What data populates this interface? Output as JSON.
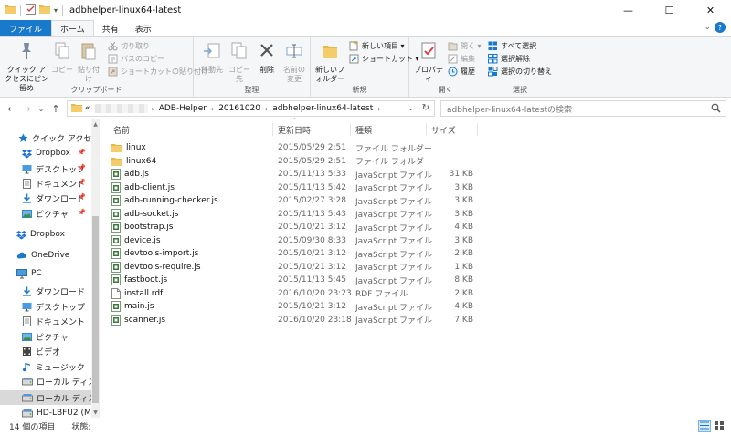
{
  "window": {
    "title": "adbhelper-linux64-latest",
    "minimize": "—",
    "maximize": "☐",
    "close": "✕"
  },
  "tabs": {
    "file": "ファイル",
    "home": "ホーム",
    "share": "共有",
    "view": "表示",
    "toggle": "⌄",
    "help": "?"
  },
  "ribbon": {
    "clipboard": {
      "pin": "クイック アクセスにピン留め",
      "copy": "コピー",
      "paste": "貼り付け",
      "cut": "切り取り",
      "copy_path": "パスのコピー",
      "paste_shortcut": "ショートカットの貼り付け",
      "label": "クリップボード"
    },
    "organize": {
      "move_to": "移動先",
      "copy_to": "コピー先",
      "delete": "削除",
      "rename": "名前の変更",
      "label": "整理"
    },
    "new": {
      "new_folder": "新しいフォルダー",
      "new_item": "新しい項目 ▾",
      "shortcut": "ショートカット ▾",
      "label": "新規"
    },
    "open": {
      "properties": "プロパティ",
      "open": "開く ▾",
      "edit": "編集",
      "history": "履歴",
      "label": "開く"
    },
    "select": {
      "select_all": "すべて選択",
      "select_none": "選択解除",
      "invert": "選択の切り替え",
      "label": "選択"
    }
  },
  "address": {
    "prefix": "«",
    "crumbs": [
      "ADB-Helper",
      "20161020",
      "adbhelper-linux64-latest"
    ],
    "dropdown": "⌄",
    "refresh": "↻",
    "search_placeholder": "adbhelper-linux64-latestの検索"
  },
  "sidebar": {
    "items": [
      {
        "label": "クイック アクセス",
        "icon": "star-icon",
        "pinned": false
      },
      {
        "label": "Dropbox",
        "icon": "dropbox-icon",
        "pinned": true
      },
      {
        "label": "デスクトップ",
        "icon": "desktop-icon",
        "pinned": true
      },
      {
        "label": "ドキュメント",
        "icon": "document-icon",
        "pinned": true
      },
      {
        "label": "ダウンロード",
        "icon": "download-icon",
        "pinned": true
      },
      {
        "label": "ピクチャ",
        "icon": "picture-icon",
        "pinned": true
      },
      {
        "label": "Dropbox",
        "icon": "dropbox-icon",
        "pinned": false
      },
      {
        "label": "OneDrive",
        "icon": "cloud-icon",
        "pinned": false
      },
      {
        "label": "PC",
        "icon": "pc-icon",
        "pinned": false
      },
      {
        "label": "ダウンロード",
        "icon": "download-icon",
        "pinned": false
      },
      {
        "label": "デスクトップ",
        "icon": "desktop-icon",
        "pinned": false
      },
      {
        "label": "ドキュメント",
        "icon": "document-icon",
        "pinned": false
      },
      {
        "label": "ピクチャ",
        "icon": "picture-icon",
        "pinned": false
      },
      {
        "label": "ビデオ",
        "icon": "video-icon",
        "pinned": false
      },
      {
        "label": "ミュージック",
        "icon": "music-icon",
        "pinned": false
      },
      {
        "label": "ローカル ディスク (C",
        "icon": "drive-icon",
        "pinned": false
      },
      {
        "label": "ローカル ディスク (D",
        "icon": "drive-icon",
        "pinned": false
      },
      {
        "label": "HD-LBFU2 (M:)",
        "icon": "drive-icon",
        "pinned": false
      }
    ]
  },
  "columns": {
    "name": "名前",
    "date": "更新日時",
    "type": "種類",
    "size": "サイズ",
    "sort_indicator": "^"
  },
  "files": [
    {
      "name": "linux",
      "date": "2015/05/29 2:51",
      "type": "ファイル フォルダー",
      "size": "",
      "icon": "folder-icon"
    },
    {
      "name": "linux64",
      "date": "2015/05/29 2:51",
      "type": "ファイル フォルダー",
      "size": "",
      "icon": "folder-icon"
    },
    {
      "name": "adb.js",
      "date": "2015/11/13 5:33",
      "type": "JavaScript ファイル",
      "size": "31 KB",
      "icon": "js-file-icon"
    },
    {
      "name": "adb-client.js",
      "date": "2015/11/13 5:42",
      "type": "JavaScript ファイル",
      "size": "3 KB",
      "icon": "js-file-icon"
    },
    {
      "name": "adb-running-checker.js",
      "date": "2015/02/27 3:28",
      "type": "JavaScript ファイル",
      "size": "3 KB",
      "icon": "js-file-icon"
    },
    {
      "name": "adb-socket.js",
      "date": "2015/11/13 5:43",
      "type": "JavaScript ファイル",
      "size": "3 KB",
      "icon": "js-file-icon"
    },
    {
      "name": "bootstrap.js",
      "date": "2015/10/21 3:12",
      "type": "JavaScript ファイル",
      "size": "4 KB",
      "icon": "js-file-icon"
    },
    {
      "name": "device.js",
      "date": "2015/09/30 8:33",
      "type": "JavaScript ファイル",
      "size": "3 KB",
      "icon": "js-file-icon"
    },
    {
      "name": "devtools-import.js",
      "date": "2015/10/21 3:12",
      "type": "JavaScript ファイル",
      "size": "2 KB",
      "icon": "js-file-icon"
    },
    {
      "name": "devtools-require.js",
      "date": "2015/10/21 3:12",
      "type": "JavaScript ファイル",
      "size": "1 KB",
      "icon": "js-file-icon"
    },
    {
      "name": "fastboot.js",
      "date": "2015/11/13 5:45",
      "type": "JavaScript ファイル",
      "size": "8 KB",
      "icon": "js-file-icon"
    },
    {
      "name": "install.rdf",
      "date": "2016/10/20 23:23",
      "type": "RDF ファイル",
      "size": "2 KB",
      "icon": "rdf-file-icon"
    },
    {
      "name": "main.js",
      "date": "2015/10/21 3:12",
      "type": "JavaScript ファイル",
      "size": "4 KB",
      "icon": "js-file-icon"
    },
    {
      "name": "scanner.js",
      "date": "2016/10/20 23:18",
      "type": "JavaScript ファイル",
      "size": "7 KB",
      "icon": "js-file-icon"
    }
  ],
  "status": {
    "item_count": "14 個の項目",
    "cloud_status": "状態:"
  },
  "colors": {
    "accent": "#1979ca",
    "folder": "#e8b84a",
    "selected": "#d9d9d9"
  }
}
